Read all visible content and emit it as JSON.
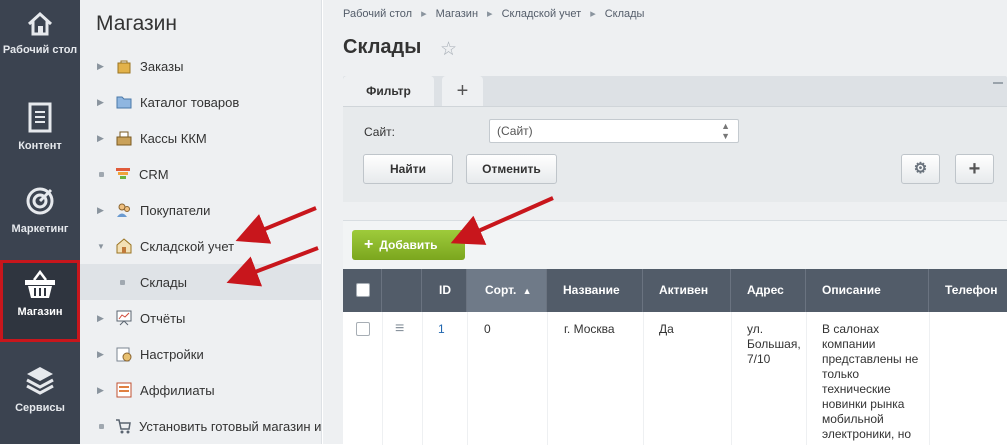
{
  "iconbar": {
    "items": [
      {
        "label": "Рабочий стол",
        "icon": "home-icon"
      },
      {
        "label": "Контент",
        "icon": "document-icon"
      },
      {
        "label": "Маркетинг",
        "icon": "target-icon"
      },
      {
        "label": "Магазин",
        "icon": "basket-icon",
        "active": true
      },
      {
        "label": "Сервисы",
        "icon": "layers-icon"
      }
    ]
  },
  "menu": {
    "title": "Магазин",
    "items": [
      {
        "label": "Заказы",
        "icon": "bag-icon"
      },
      {
        "label": "Каталог товаров",
        "icon": "folder-icon"
      },
      {
        "label": "Кассы ККМ",
        "icon": "register-icon"
      },
      {
        "label": "CRM",
        "icon": "funnel-icon"
      },
      {
        "label": "Покупатели",
        "icon": "users-icon"
      },
      {
        "label": "Складской учет",
        "icon": "warehouse-icon"
      },
      {
        "label": "Склады",
        "icon": "bullet"
      },
      {
        "label": "Отчёты",
        "icon": "chart-board-icon"
      },
      {
        "label": "Настройки",
        "icon": "settings-icon"
      },
      {
        "label": "Аффилиаты",
        "icon": "affiliate-icon"
      },
      {
        "label": "Установить готовый магазин и",
        "icon": "cart-icon"
      }
    ]
  },
  "breadcrumbs": [
    "Рабочий стол",
    "Магазин",
    "Складской учет",
    "Склады"
  ],
  "page": {
    "title": "Склады"
  },
  "filter": {
    "tab": "Фильтр",
    "site_label": "Сайт:",
    "site_value": "(Сайт)",
    "find_button": "Найти",
    "cancel_button": "Отменить"
  },
  "list": {
    "add_button": "Добавить",
    "columns": [
      "ID",
      "Сорт.",
      "Название",
      "Активен",
      "Адрес",
      "Описание",
      "Телефон"
    ],
    "rows": [
      {
        "id": "1",
        "sort": "0",
        "name": "г. Москва",
        "active": "Да",
        "address": [
          "ул.",
          "Большая,",
          "7/10"
        ],
        "description": [
          "В салонах",
          "компании",
          "представлены не",
          "только",
          "технические",
          "новинки рынка",
          "мобильной",
          "электроники, но"
        ],
        "phone": ""
      }
    ]
  },
  "colors": {
    "iconbar_bg": "#3b4350",
    "active_outline": "#c8161c",
    "header_bg": "#525c69",
    "add_button": "#8ab82c",
    "annotation_arrow": "#c8161c"
  }
}
